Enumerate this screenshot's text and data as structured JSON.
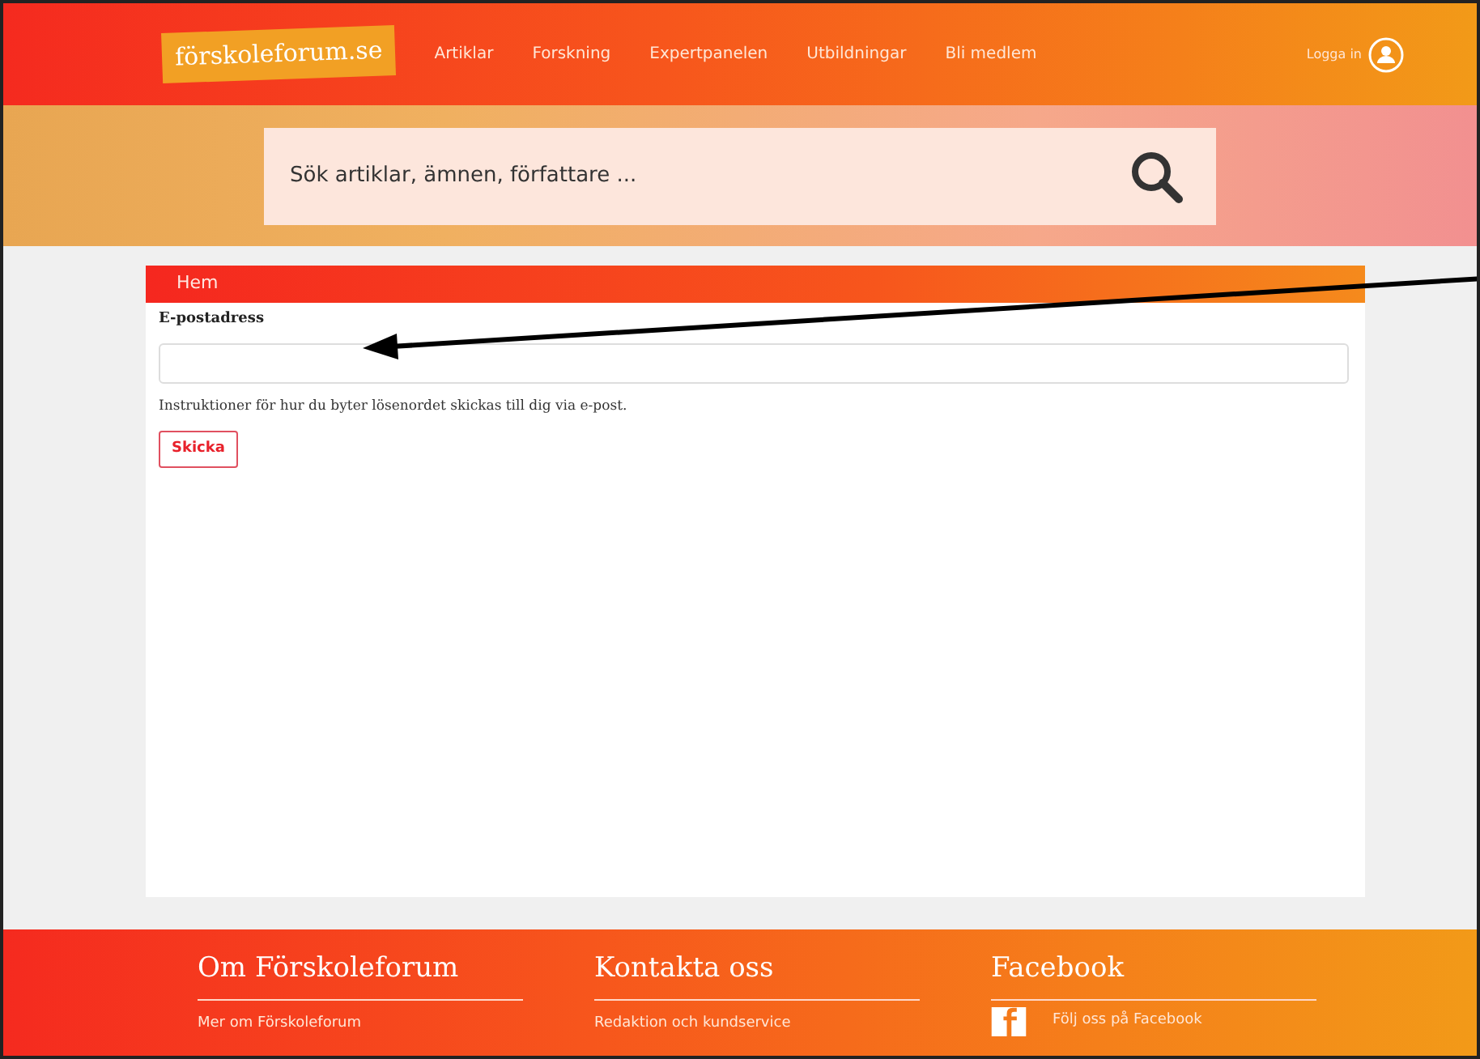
{
  "header": {
    "logo": "förskoleforum.se",
    "nav": [
      {
        "label": "Artiklar"
      },
      {
        "label": "Forskning"
      },
      {
        "label": "Expertpanelen"
      },
      {
        "label": "Utbildningar"
      },
      {
        "label": "Bli medlem"
      }
    ],
    "login": "Logga in"
  },
  "search": {
    "placeholder": "Sök artiklar, ämnen, författare ..."
  },
  "breadcrumb": "Hem",
  "form": {
    "label": "E-postadress",
    "help": "Instruktioner för hur du byter lösenordet skickas till dig via e-post.",
    "button": "Skicka"
  },
  "footer": [
    {
      "heading": "Om Förskoleforum",
      "link": "Mer om Förskoleforum",
      "kind": "text"
    },
    {
      "heading": "Kontakta oss",
      "link": "Redaktion och kundservice",
      "kind": "text"
    },
    {
      "heading": "Facebook",
      "link": "Följ oss på Facebook",
      "kind": "facebook"
    }
  ]
}
